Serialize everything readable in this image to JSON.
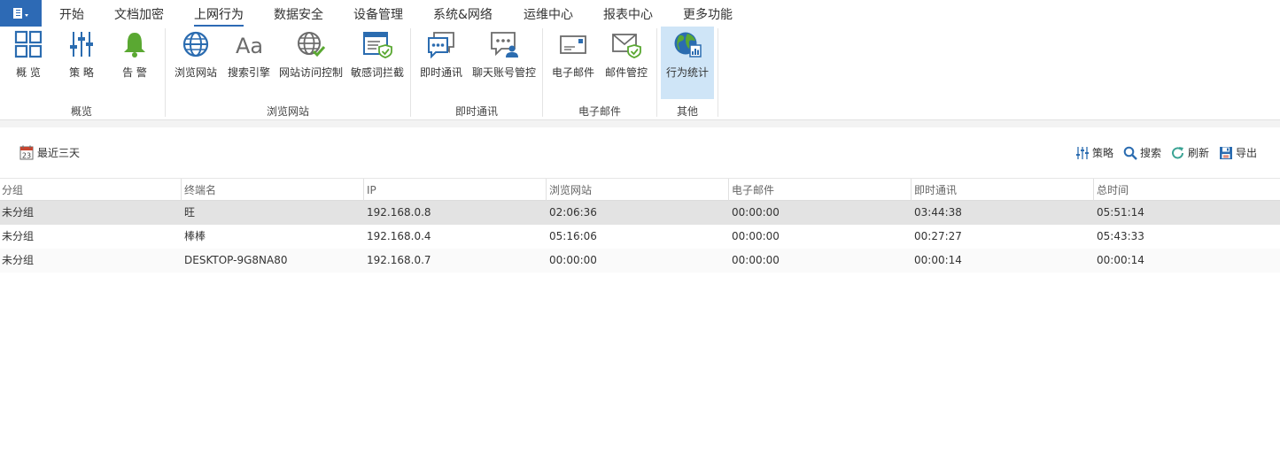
{
  "menu": {
    "items": [
      {
        "label": "开始"
      },
      {
        "label": "文档加密"
      },
      {
        "label": "上网行为"
      },
      {
        "label": "数据安全"
      },
      {
        "label": "设备管理"
      },
      {
        "label": "系统&网络"
      },
      {
        "label": "运维中心"
      },
      {
        "label": "报表中心"
      },
      {
        "label": "更多功能"
      }
    ],
    "active_index": 2
  },
  "ribbon": {
    "groups": [
      {
        "label": "概览",
        "buttons": [
          {
            "label": "概 览",
            "icon": "grid-icon"
          },
          {
            "label": "策 略",
            "icon": "sliders-icon"
          },
          {
            "label": "告 警",
            "icon": "bell-icon"
          }
        ]
      },
      {
        "label": "浏览网站",
        "buttons": [
          {
            "label": "浏览网站",
            "icon": "globe-icon"
          },
          {
            "label": "搜索引擎",
            "icon": "font-aa-icon"
          },
          {
            "label": "网站访问控制",
            "icon": "globe-check-icon"
          },
          {
            "label": "敏感词拦截",
            "icon": "window-shield-icon"
          }
        ]
      },
      {
        "label": "即时通讯",
        "buttons": [
          {
            "label": "即时通讯",
            "icon": "chat-bubbles-icon"
          },
          {
            "label": "聊天账号管控",
            "icon": "chat-user-icon"
          }
        ]
      },
      {
        "label": "电子邮件",
        "buttons": [
          {
            "label": "电子邮件",
            "icon": "envelope-icon"
          },
          {
            "label": "邮件管控",
            "icon": "envelope-shield-icon"
          }
        ]
      },
      {
        "label": "其他",
        "buttons": [
          {
            "label": "行为统计",
            "icon": "globe-stats-icon",
            "selected": true
          }
        ]
      }
    ]
  },
  "toolbar": {
    "date_range_label": "最近三天",
    "calendar_day": "23",
    "strategy_label": "策略",
    "search_label": "搜索",
    "refresh_label": "刷新",
    "export_label": "导出"
  },
  "table": {
    "columns": [
      "分组",
      "终端名",
      "IP",
      "浏览网站",
      "电子邮件",
      "即时通讯",
      "总时间"
    ],
    "rows": [
      [
        "未分组",
        "旺",
        "192.168.0.8",
        "02:06:36",
        "00:00:00",
        "03:44:38",
        "05:51:14"
      ],
      [
        "未分组",
        "棒棒",
        "192.168.0.4",
        "05:16:06",
        "00:00:00",
        "00:27:27",
        "05:43:33"
      ],
      [
        "未分组",
        "DESKTOP-9G8NA80",
        "192.168.0.7",
        "00:00:00",
        "00:00:00",
        "00:00:14",
        "00:00:14"
      ]
    ],
    "selected_row": 0
  },
  "colors": {
    "accent": "#2d6ab5",
    "icon_blue": "#2b6cb0",
    "icon_gray": "#6b6b6b",
    "icon_green": "#5aa832",
    "selected_ribbon": "#cfe5f7",
    "selected_row": "#e3e3e3"
  }
}
